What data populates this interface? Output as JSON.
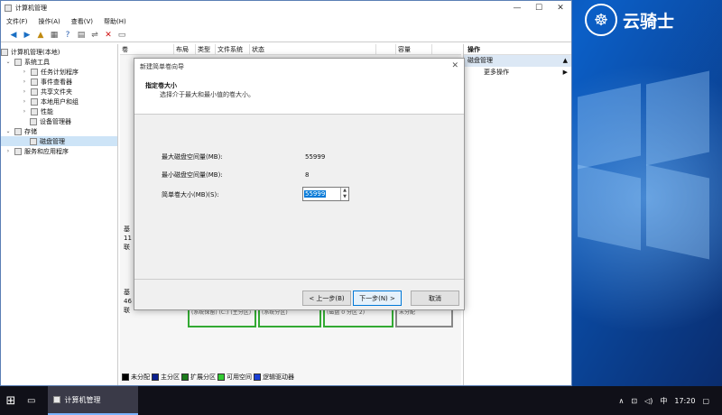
{
  "desktop": {
    "brand": "云骑士",
    "logo_glyph": "☸"
  },
  "window": {
    "title": "计算机管理",
    "controls": {
      "min": "—",
      "max": "☐",
      "close": "✕"
    },
    "menu": [
      "文件(F)",
      "操作(A)",
      "查看(V)",
      "帮助(H)"
    ]
  },
  "tree": {
    "root": "计算机管理(本地)",
    "system_tools": "系统工具",
    "task_scheduler": "任务计划程序",
    "event_viewer": "事件查看器",
    "shared_folders": "共享文件夹",
    "local_users": "本地用户和组",
    "performance": "性能",
    "device_manager": "设备管理器",
    "storage": "存储",
    "disk_mgmt": "磁盘管理",
    "services": "服务和应用程序"
  },
  "columns": [
    "卷",
    "布局",
    "类型",
    "文件系统",
    "状态",
    "",
    "容量"
  ],
  "disks": {
    "d0a": "基",
    "d0b": "11",
    "d0c": "联",
    "d1a": "基",
    "d1b": "46",
    "d1c": "联"
  },
  "partitions": [
    "(系统保留) (C:)  (主分区)",
    "(系统分区)",
    "(磁盘 0 分区 2)",
    "未分配"
  ],
  "legend": [
    "未分配",
    "主分区",
    "扩展分区",
    "可用空间",
    "逻辑驱动器"
  ],
  "legend_colors": [
    "#000000",
    "#0a1f8f",
    "#1a7a1a",
    "#33cc33",
    "#1a3fd6"
  ],
  "actions": {
    "header": "操作",
    "section": "磁盘管理",
    "more": "更多操作"
  },
  "dialog": {
    "title": "新建简单卷向导",
    "heading": "指定卷大小",
    "subtitle": "选择介于最大和最小值的卷大小。",
    "max_label": "最大磁盘空间量(MB):",
    "max_value": "55999",
    "min_label": "最小磁盘空间量(MB):",
    "min_value": "8",
    "size_label": "简单卷大小(MB)(S):",
    "size_value": "55999",
    "back": "< 上一步(B)",
    "next": "下一步(N) >",
    "cancel": "取消"
  },
  "taskbar": {
    "app": "计算机管理",
    "ime": "中",
    "time": "17:20"
  }
}
